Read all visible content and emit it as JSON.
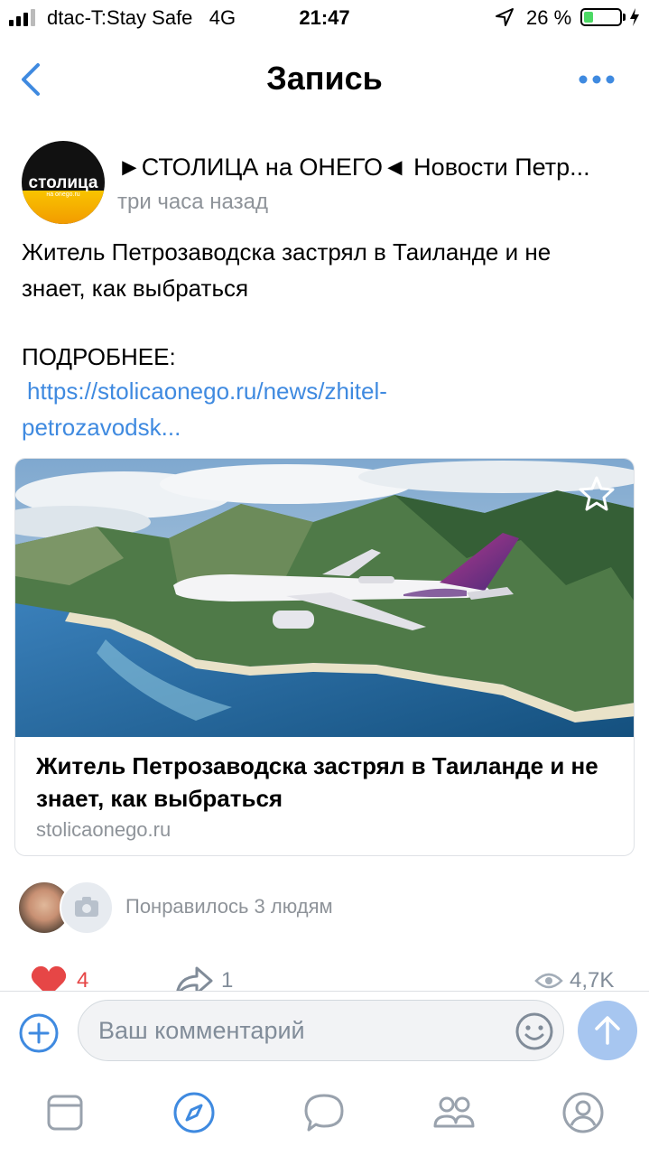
{
  "status_bar": {
    "carrier": "dtac-T:Stay Safe",
    "network": "4G",
    "time": "21:47",
    "battery_percent": "26 %",
    "battery_level": 0.26,
    "battery_color": "#4cd964",
    "location_icon": "location-arrow-icon",
    "charging_icon": "bolt-icon"
  },
  "nav": {
    "title": "Запись",
    "back_icon": "chevron-left-icon",
    "more_icon": "more-dots-icon",
    "accent_color": "#3f8ae0"
  },
  "post": {
    "author": "►СТОЛИЦА на ОНЕГО◄ Новости Петр...",
    "time": "три часа назад",
    "avatar_logo": "столица",
    "avatar_logo_sub": "на onego.ru",
    "text_line1": "Житель Петрозаводска застрял в Таиланде и не",
    "text_line2": "знает, как выбраться",
    "more_label": "ПОДРОБНЕЕ:",
    "link_line1": "https://stolicaonego.ru/news/zhitel-",
    "link_line2": "petrozavodsk..."
  },
  "card": {
    "title": "Житель Петрозаводска застрял в Таиланде и не знает, как выбраться",
    "domain": "stolicaonego.ru",
    "star_icon": "star-outline-icon"
  },
  "likes": {
    "text": "Понравилось 3 людям",
    "camera_icon": "camera-icon"
  },
  "actions": {
    "like_count": "4",
    "share_count": "1",
    "views": "4,7K",
    "like_color": "#e64646"
  },
  "comment_bar": {
    "placeholder": "Ваш комментарий",
    "plus_icon": "plus-circle-icon",
    "emoji_icon": "smile-icon",
    "send_icon": "arrow-up-icon",
    "send_color": "#a7c6f0"
  },
  "tabbar": {
    "items": [
      "news-icon",
      "explore-icon",
      "messages-icon",
      "friends-icon",
      "profile-icon"
    ]
  }
}
